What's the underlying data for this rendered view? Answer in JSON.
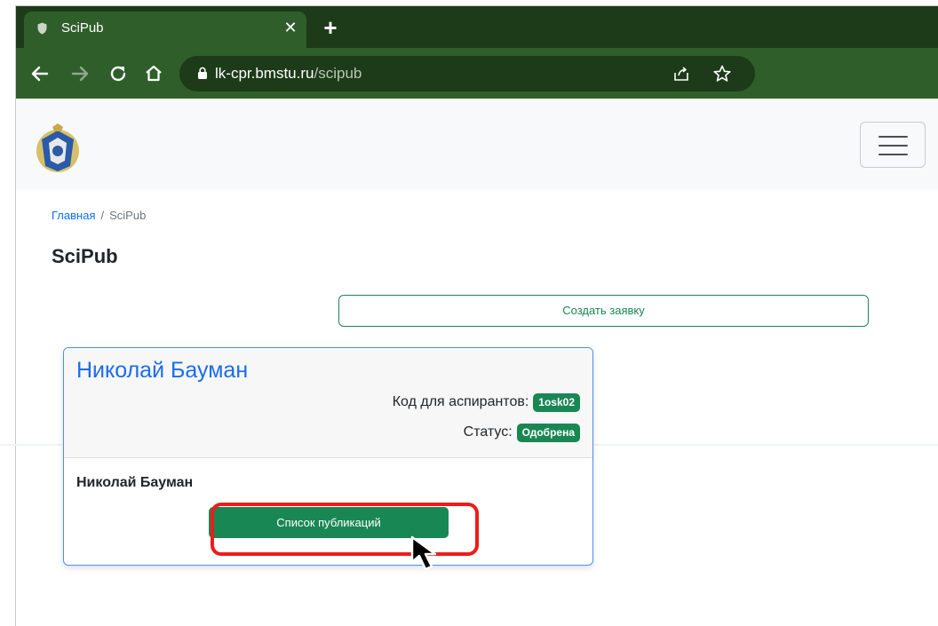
{
  "browser": {
    "tab": {
      "title": "SciPub",
      "close_glyph": "✕"
    },
    "new_tab_glyph": "+",
    "url": {
      "host": "lk-cpr.bmstu.ru",
      "path": "/scipub"
    },
    "icons": [
      "shield-favicon-icon",
      "arrow-left-icon",
      "arrow-right-icon",
      "reload-icon",
      "home-icon",
      "lock-icon",
      "share-icon",
      "star-icon"
    ]
  },
  "header": {
    "logo_icon": "university-crest-icon",
    "menu_icon": "hamburger-menu-icon"
  },
  "breadcrumb": {
    "home": "Главная",
    "separator": "/",
    "current": "SciPub"
  },
  "page": {
    "title": "SciPub",
    "create_button": "Создать заявку"
  },
  "card": {
    "title": "Николай Бауман",
    "code_label": "Код для аспирантов:",
    "code_value": "1osk02",
    "status_label": "Статус:",
    "status_value": "Одобрена",
    "name": "Николай Бауман",
    "publications_button": "Список публикаций"
  },
  "colors": {
    "tab_strip": "#1d3b18",
    "toolbar": "#2f5e2a",
    "accent_green": "#198754",
    "link_blue": "#0d6efd",
    "card_border": "#4d8ef5",
    "highlight_red": "#ee1b1b"
  }
}
